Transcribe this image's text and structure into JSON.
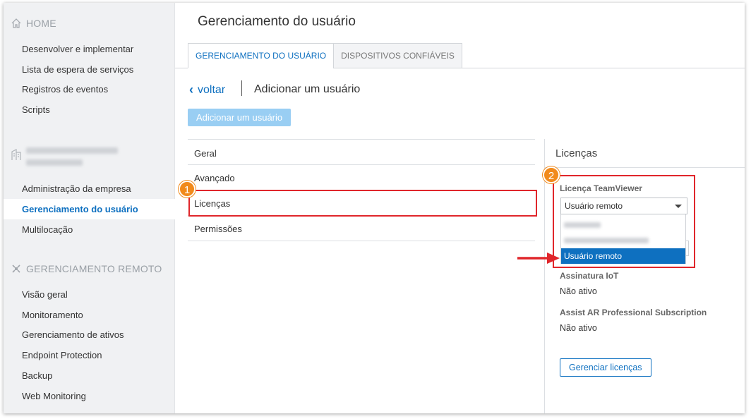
{
  "sidebar": {
    "sections": [
      {
        "title": "HOME",
        "icon": "home-icon"
      },
      {
        "title": "GERENCIAMENTO REMOTO",
        "icon": "remote-management-icon"
      }
    ],
    "home_items": [
      "Desenvolver e implementar",
      "Lista de espera de serviços",
      "Registros de eventos",
      "Scripts"
    ],
    "company_icon": "building-icon",
    "company_items": [
      "Administração da empresa",
      "Gerenciamento do usuário",
      "Multilocação"
    ],
    "active_item": "Gerenciamento do usuário",
    "remote_items": [
      "Visão geral",
      "Monitoramento",
      "Gerenciamento de ativos",
      "Endpoint Protection",
      "Backup",
      "Web Monitoring"
    ]
  },
  "main": {
    "page_title": "Gerenciamento do usuário",
    "tabs": [
      {
        "label": "GERENCIAMENTO DO USUÁRIO",
        "active": true
      },
      {
        "label": "DISPOSITIVOS CONFIÁVEIS",
        "active": false
      }
    ],
    "back_label": "voltar",
    "back_icon": "chevron-left-icon",
    "sub_title": "Adicionar um usuário",
    "add_button": "Adicionar um usuário",
    "menu_items": [
      "Geral",
      "Avançado",
      "Licenças",
      "Permissões"
    ]
  },
  "licenses": {
    "title": "Licenças",
    "teamviewer_label": "Licença TeamViewer",
    "teamviewer_value": "Usuário remoto",
    "dropdown_selected": "Usuário remoto",
    "iot_label": "Assinatura IoT",
    "iot_value": "Não ativo",
    "assist_label": "Assist AR Professional Subscription",
    "assist_value": "Não ativo",
    "manage_button": "Gerenciar licenças"
  },
  "annotations": {
    "badge_1": "1",
    "badge_2": "2",
    "highlight_color": "#e0262b",
    "badge_color": "#f18a1c"
  },
  "colors": {
    "accent": "#0e70c0",
    "sidebar_bg": "#f0f1f3",
    "disabled_button": "#99cef3"
  }
}
